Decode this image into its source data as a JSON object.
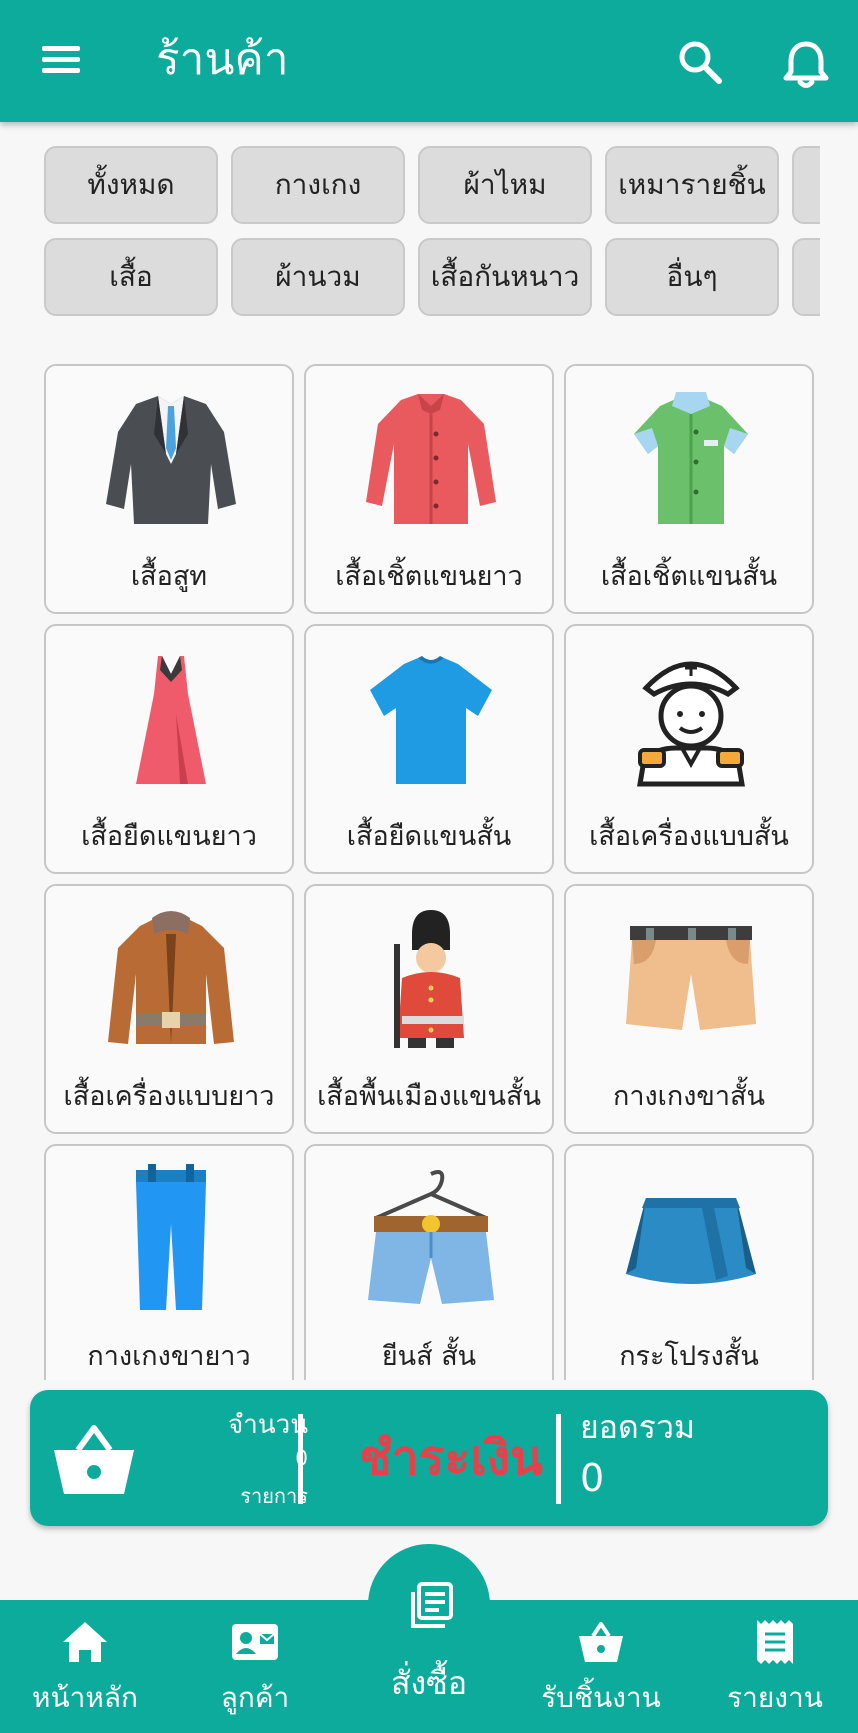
{
  "header": {
    "title": "ร้านค้า",
    "notification_count": "0"
  },
  "categories": [
    {
      "label": "ทั้งหมด"
    },
    {
      "label": "กางเกง"
    },
    {
      "label": "ผ้าไหม"
    },
    {
      "label": "เหมารายชิ้น"
    },
    {
      "label": "เสื้อ"
    },
    {
      "label": "ผ้านวม"
    },
    {
      "label": "เสื้อกันหนาว"
    },
    {
      "label": "อื่นๆ"
    }
  ],
  "products": [
    {
      "label": "เสื้อสูท",
      "icon": "suit-icon"
    },
    {
      "label": "เสื้อเชิ้ตแขนยาว",
      "icon": "long-sleeve-shirt-icon"
    },
    {
      "label": "เสื้อเชิ้ตแขนสั้น",
      "icon": "short-sleeve-shirt-icon"
    },
    {
      "label": "เสื้อยืดแขนยาว",
      "icon": "dress-icon"
    },
    {
      "label": "เสื้อยืดแขนสั้น",
      "icon": "t-shirt-icon"
    },
    {
      "label": "เสื้อเครื่องแบบสั้น",
      "icon": "sailor-uniform-icon"
    },
    {
      "label": "เสื้อเครื่องแบบยาว",
      "icon": "leather-jacket-icon"
    },
    {
      "label": "เสื้อพื้นเมืองแขนสั้น",
      "icon": "royal-guard-icon"
    },
    {
      "label": "กางเกงขาสั้น",
      "icon": "shorts-icon"
    },
    {
      "label": "กางเกงขายาว",
      "icon": "trousers-icon"
    },
    {
      "label": "ยีนส์ สั้น",
      "icon": "jeans-shorts-icon"
    },
    {
      "label": "กระโปรงสั้น",
      "icon": "skirt-icon"
    }
  ],
  "checkout": {
    "qty_title": "จำนวน",
    "qty_value": "0",
    "qty_unit": "รายการ",
    "pay_label": "ชำระเงิน",
    "total_title": "ยอดรวม",
    "total_value": "0"
  },
  "nav": [
    {
      "label": "หน้าหลัก",
      "icon": "home-icon"
    },
    {
      "label": "ลูกค้า",
      "icon": "contact-card-icon"
    },
    {
      "label": "สั่งซื้อ",
      "icon": "order-list-icon"
    },
    {
      "label": "รับชิ้นงาน",
      "icon": "basket-icon"
    },
    {
      "label": "รายงาน",
      "icon": "receipt-icon"
    }
  ],
  "colors": {
    "primary": "#0dab9c",
    "pay": "#e8404b",
    "badge": "#ff5722",
    "chip": "#dcdcdc"
  }
}
